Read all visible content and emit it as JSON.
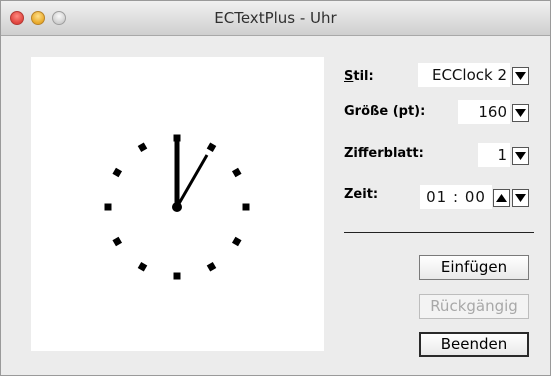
{
  "window": {
    "title": "ECTextPlus - Uhr"
  },
  "clock": {
    "hour": 1,
    "minute": 0
  },
  "settings": {
    "style": {
      "label": "Stil:",
      "value": "ECClock 2"
    },
    "size": {
      "label": "Größe (pt):",
      "value": "160"
    },
    "dial": {
      "label": "Zifferblatt:",
      "value": "1"
    },
    "time": {
      "label": "Zeit:",
      "hours": "01",
      "separator": ":",
      "minutes": "00"
    }
  },
  "buttons": {
    "insert": "Einfügen",
    "undo": "Rückgängig",
    "quit": "Beenden"
  },
  "icons": {
    "dropdown": "chevron-down-icon",
    "up": "arrow-up-icon",
    "down": "arrow-down-icon"
  }
}
